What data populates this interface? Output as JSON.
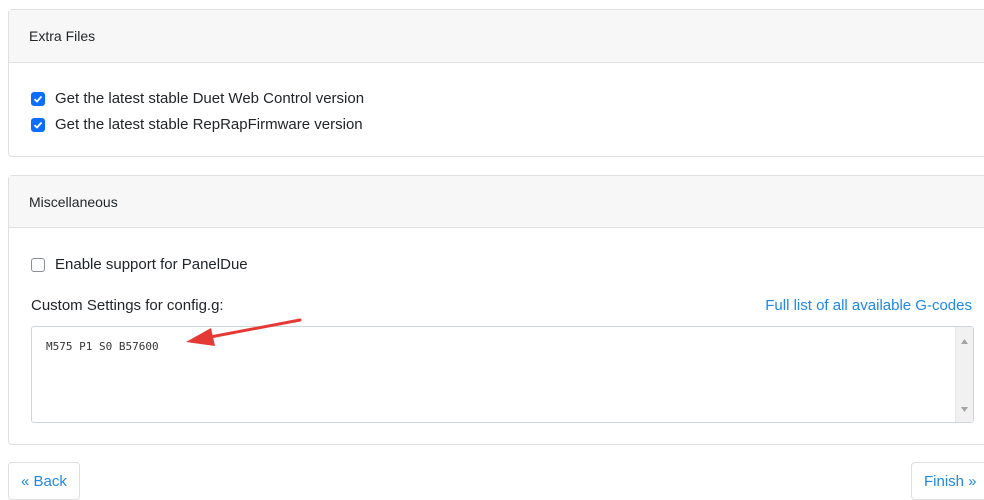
{
  "extra_files": {
    "title": "Extra Files",
    "items": [
      {
        "label": "Get the latest stable Duet Web Control version",
        "checked": true
      },
      {
        "label": "Get the latest stable RepRapFirmware version",
        "checked": true
      }
    ]
  },
  "misc": {
    "title": "Miscellaneous",
    "paneldue_label": "Enable support for PanelDue",
    "paneldue_checked": false,
    "custom_label": "Custom Settings for config.g:",
    "gcodes_link": "Full list of all available G-codes",
    "custom_value": "M575 P1 S0 B57600"
  },
  "nav": {
    "back_label": "« Back",
    "finish_label": "Finish »"
  },
  "colors": {
    "accent": "#0d6efd",
    "link": "#1e88e5",
    "annotation_arrow": "#e53935"
  }
}
